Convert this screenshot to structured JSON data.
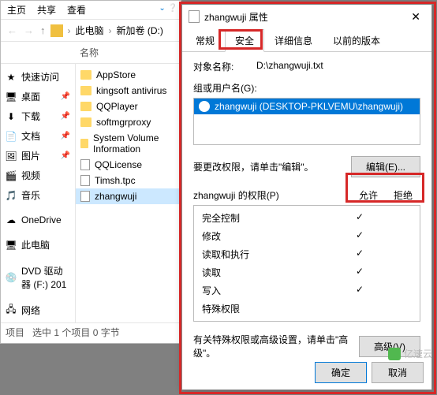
{
  "explorer": {
    "tabs": [
      "主页",
      "共享",
      "查看"
    ],
    "breadcrumb": {
      "root": "此电脑",
      "sep": "›",
      "drive": "新加卷 (D:)"
    },
    "nav_header": "快速访问",
    "col_name": "名称",
    "nav": [
      {
        "label": "桌面",
        "icon": "🖥"
      },
      {
        "label": "下载",
        "icon": "⬇"
      },
      {
        "label": "文档",
        "icon": "📄"
      },
      {
        "label": "图片",
        "icon": "🖼"
      },
      {
        "label": "视频",
        "icon": "🎬"
      },
      {
        "label": "音乐",
        "icon": "🎵"
      }
    ],
    "nav2": [
      {
        "label": "OneDrive"
      },
      {
        "label": "此电脑"
      },
      {
        "label": "DVD 驱动器 (F:) 201"
      },
      {
        "label": "网络"
      }
    ],
    "files": [
      {
        "name": "AppStore",
        "type": "folder"
      },
      {
        "name": "kingsoft antivirus",
        "type": "folder"
      },
      {
        "name": "QQPlayer",
        "type": "folder"
      },
      {
        "name": "softmgrproxy",
        "type": "folder"
      },
      {
        "name": "System Volume Information",
        "type": "folder"
      },
      {
        "name": "QQLicense",
        "type": "file"
      },
      {
        "name": "Timsh.tpc",
        "type": "file"
      },
      {
        "name": "zhangwuji",
        "type": "file",
        "selected": true
      }
    ],
    "status_items": "项目",
    "status_sel": "选中 1 个项目  0 字节"
  },
  "dialog": {
    "title": "zhangwuji 属性",
    "tabs": [
      "常规",
      "安全",
      "详细信息",
      "以前的版本"
    ],
    "object_label": "对象名称:",
    "object_value": "D:\\zhangwuji.txt",
    "group_label": "组或用户名(G):",
    "user": "zhangwuji (DESKTOP-PKLVEMU\\zhangwuji)",
    "edit_hint": "要更改权限，请单击\"编辑\"。",
    "edit_btn": "编辑(E)...",
    "perm_label": "zhangwuji 的权限(P)",
    "perm_allow": "允许",
    "perm_deny": "拒绝",
    "perms": [
      {
        "name": "完全控制",
        "allow": true,
        "deny": false
      },
      {
        "name": "修改",
        "allow": true,
        "deny": false
      },
      {
        "name": "读取和执行",
        "allow": true,
        "deny": false
      },
      {
        "name": "读取",
        "allow": true,
        "deny": false
      },
      {
        "name": "写入",
        "allow": true,
        "deny": false
      },
      {
        "name": "特殊权限",
        "allow": false,
        "deny": false
      }
    ],
    "adv_hint": "有关特殊权限或高级设置，请单击\"高级\"。",
    "adv_btn": "高级(V)",
    "ok": "确定",
    "cancel": "取消"
  },
  "watermark": "亿速云"
}
